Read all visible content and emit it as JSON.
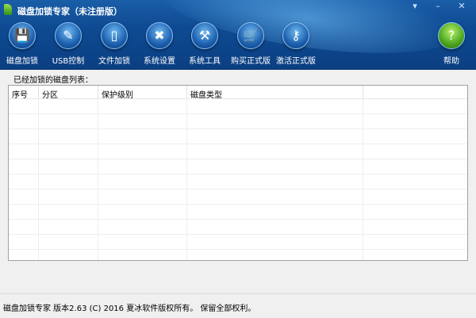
{
  "window": {
    "title": "磁盘加锁专家（未注册版）",
    "buttons": [
      "▾",
      "–",
      "✕"
    ]
  },
  "toolbar": {
    "items": [
      {
        "label": "磁盘加锁",
        "icon": "floppy-disk-icon",
        "glyph": "💾"
      },
      {
        "label": "USB控制",
        "icon": "usb-drive-icon",
        "glyph": "✎"
      },
      {
        "label": "文件加锁",
        "icon": "document-icon",
        "glyph": "▯"
      },
      {
        "label": "系统设置",
        "icon": "tools-icon",
        "glyph": "✖"
      },
      {
        "label": "系统工具",
        "icon": "wrench-icon",
        "glyph": "⚒"
      },
      {
        "label": "购买正式版",
        "icon": "cart-icon",
        "glyph": "🛒"
      },
      {
        "label": "激活正式版",
        "icon": "key-icon",
        "glyph": "⚷"
      }
    ],
    "help": {
      "label": "帮助",
      "icon": "help-icon",
      "glyph": "?"
    }
  },
  "section_label": "已经加锁的磁盘列表：",
  "table": {
    "columns": [
      "序号",
      "分区",
      "保护级别",
      "磁盘类型",
      ""
    ],
    "rows": []
  },
  "status": "磁盘加锁专家 版本2.63 (C) 2016 夏冰软件版权所有。 保留全部权利。"
}
